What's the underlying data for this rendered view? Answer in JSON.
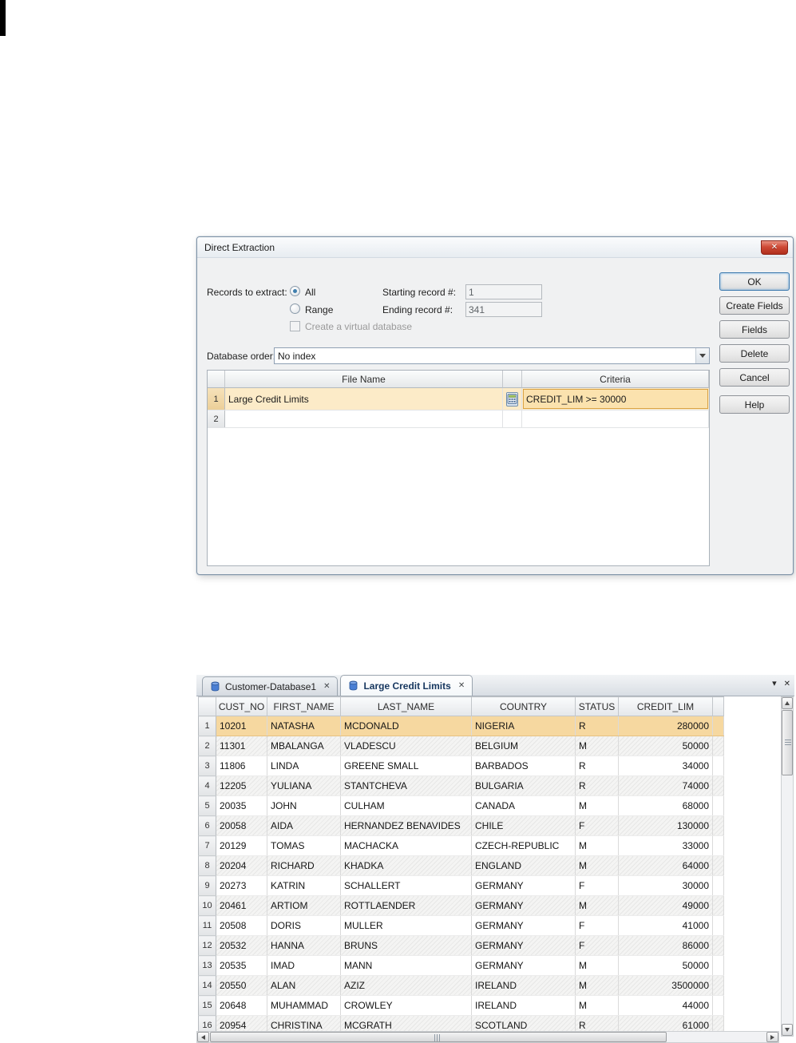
{
  "icons": {
    "close": "✕",
    "dropdown": "▾"
  },
  "dialog": {
    "title": "Direct Extraction",
    "records_to_extract_label": "Records to extract:",
    "radio_all_label": "All",
    "radio_range_label": "Range",
    "starting_record_label": "Starting record #:",
    "starting_record_value": "1",
    "ending_record_label": "Ending record #:",
    "ending_record_value": "341",
    "virtual_db_label": "Create a virtual database",
    "database_order_label": "Database order:",
    "database_order_value": "No index",
    "grid": {
      "file_name_header": "File Name",
      "criteria_header": "Criteria",
      "rows": [
        {
          "num": "1",
          "file_name": "Large Credit Limits",
          "criteria": "CREDIT_LIM >= 30000"
        },
        {
          "num": "2",
          "file_name": "",
          "criteria": ""
        }
      ]
    },
    "buttons": {
      "ok": "OK",
      "create_fields": "Create Fields",
      "fields": "Fields",
      "delete": "Delete",
      "cancel": "Cancel",
      "help": "Help"
    }
  },
  "workspace": {
    "tabs": [
      {
        "label": "Customer-Database1"
      },
      {
        "label": "Large Credit Limits"
      }
    ],
    "table": {
      "columns": [
        "CUST_NO",
        "FIRST_NAME",
        "LAST_NAME",
        "COUNTRY",
        "STATUS",
        "CREDIT_LIM"
      ],
      "rows": [
        {
          "num": "1",
          "selected": true,
          "cells": [
            "10201",
            "NATASHA",
            "MCDONALD",
            "NIGERIA",
            "R",
            "280000"
          ]
        },
        {
          "num": "2",
          "selected": false,
          "cells": [
            "11301",
            "MBALANGA",
            "VLADESCU",
            "BELGIUM",
            "M",
            "50000"
          ]
        },
        {
          "num": "3",
          "selected": false,
          "cells": [
            "11806",
            "LINDA",
            "GREENE SMALL",
            "BARBADOS",
            "R",
            "34000"
          ]
        },
        {
          "num": "4",
          "selected": false,
          "cells": [
            "12205",
            "YULIANA",
            "STANTCHEVA",
            "BULGARIA",
            "R",
            "74000"
          ]
        },
        {
          "num": "5",
          "selected": false,
          "cells": [
            "20035",
            "JOHN",
            "CULHAM",
            "CANADA",
            "M",
            "68000"
          ]
        },
        {
          "num": "6",
          "selected": false,
          "cells": [
            "20058",
            "AIDA",
            "HERNANDEZ BENAVIDES",
            "CHILE",
            "F",
            "130000"
          ]
        },
        {
          "num": "7",
          "selected": false,
          "cells": [
            "20129",
            "TOMAS",
            "MACHACKA",
            "CZECH-REPUBLIC",
            "M",
            "33000"
          ]
        },
        {
          "num": "8",
          "selected": false,
          "cells": [
            "20204",
            "RICHARD",
            "KHADKA",
            "ENGLAND",
            "M",
            "64000"
          ]
        },
        {
          "num": "9",
          "selected": false,
          "cells": [
            "20273",
            "KATRIN",
            "SCHALLERT",
            "GERMANY",
            "F",
            "30000"
          ]
        },
        {
          "num": "10",
          "selected": false,
          "cells": [
            "20461",
            "ARTIOM",
            "ROTTLAENDER",
            "GERMANY",
            "M",
            "49000"
          ]
        },
        {
          "num": "11",
          "selected": false,
          "cells": [
            "20508",
            "DORIS",
            "MULLER",
            "GERMANY",
            "F",
            "41000"
          ]
        },
        {
          "num": "12",
          "selected": false,
          "cells": [
            "20532",
            "HANNA",
            "BRUNS",
            "GERMANY",
            "F",
            "86000"
          ]
        },
        {
          "num": "13",
          "selected": false,
          "cells": [
            "20535",
            "IMAD",
            "MANN",
            "GERMANY",
            "M",
            "50000"
          ]
        },
        {
          "num": "14",
          "selected": false,
          "cells": [
            "20550",
            "ALAN",
            "AZIZ",
            "IRELAND",
            "M",
            "3500000"
          ]
        },
        {
          "num": "15",
          "selected": false,
          "cells": [
            "20648",
            "MUHAMMAD",
            "CROWLEY",
            "IRELAND",
            "M",
            "44000"
          ]
        },
        {
          "num": "16",
          "selected": false,
          "cells": [
            "20954",
            "CHRISTINA",
            "MCGRATH",
            "SCOTLAND",
            "R",
            "61000"
          ]
        }
      ]
    }
  }
}
